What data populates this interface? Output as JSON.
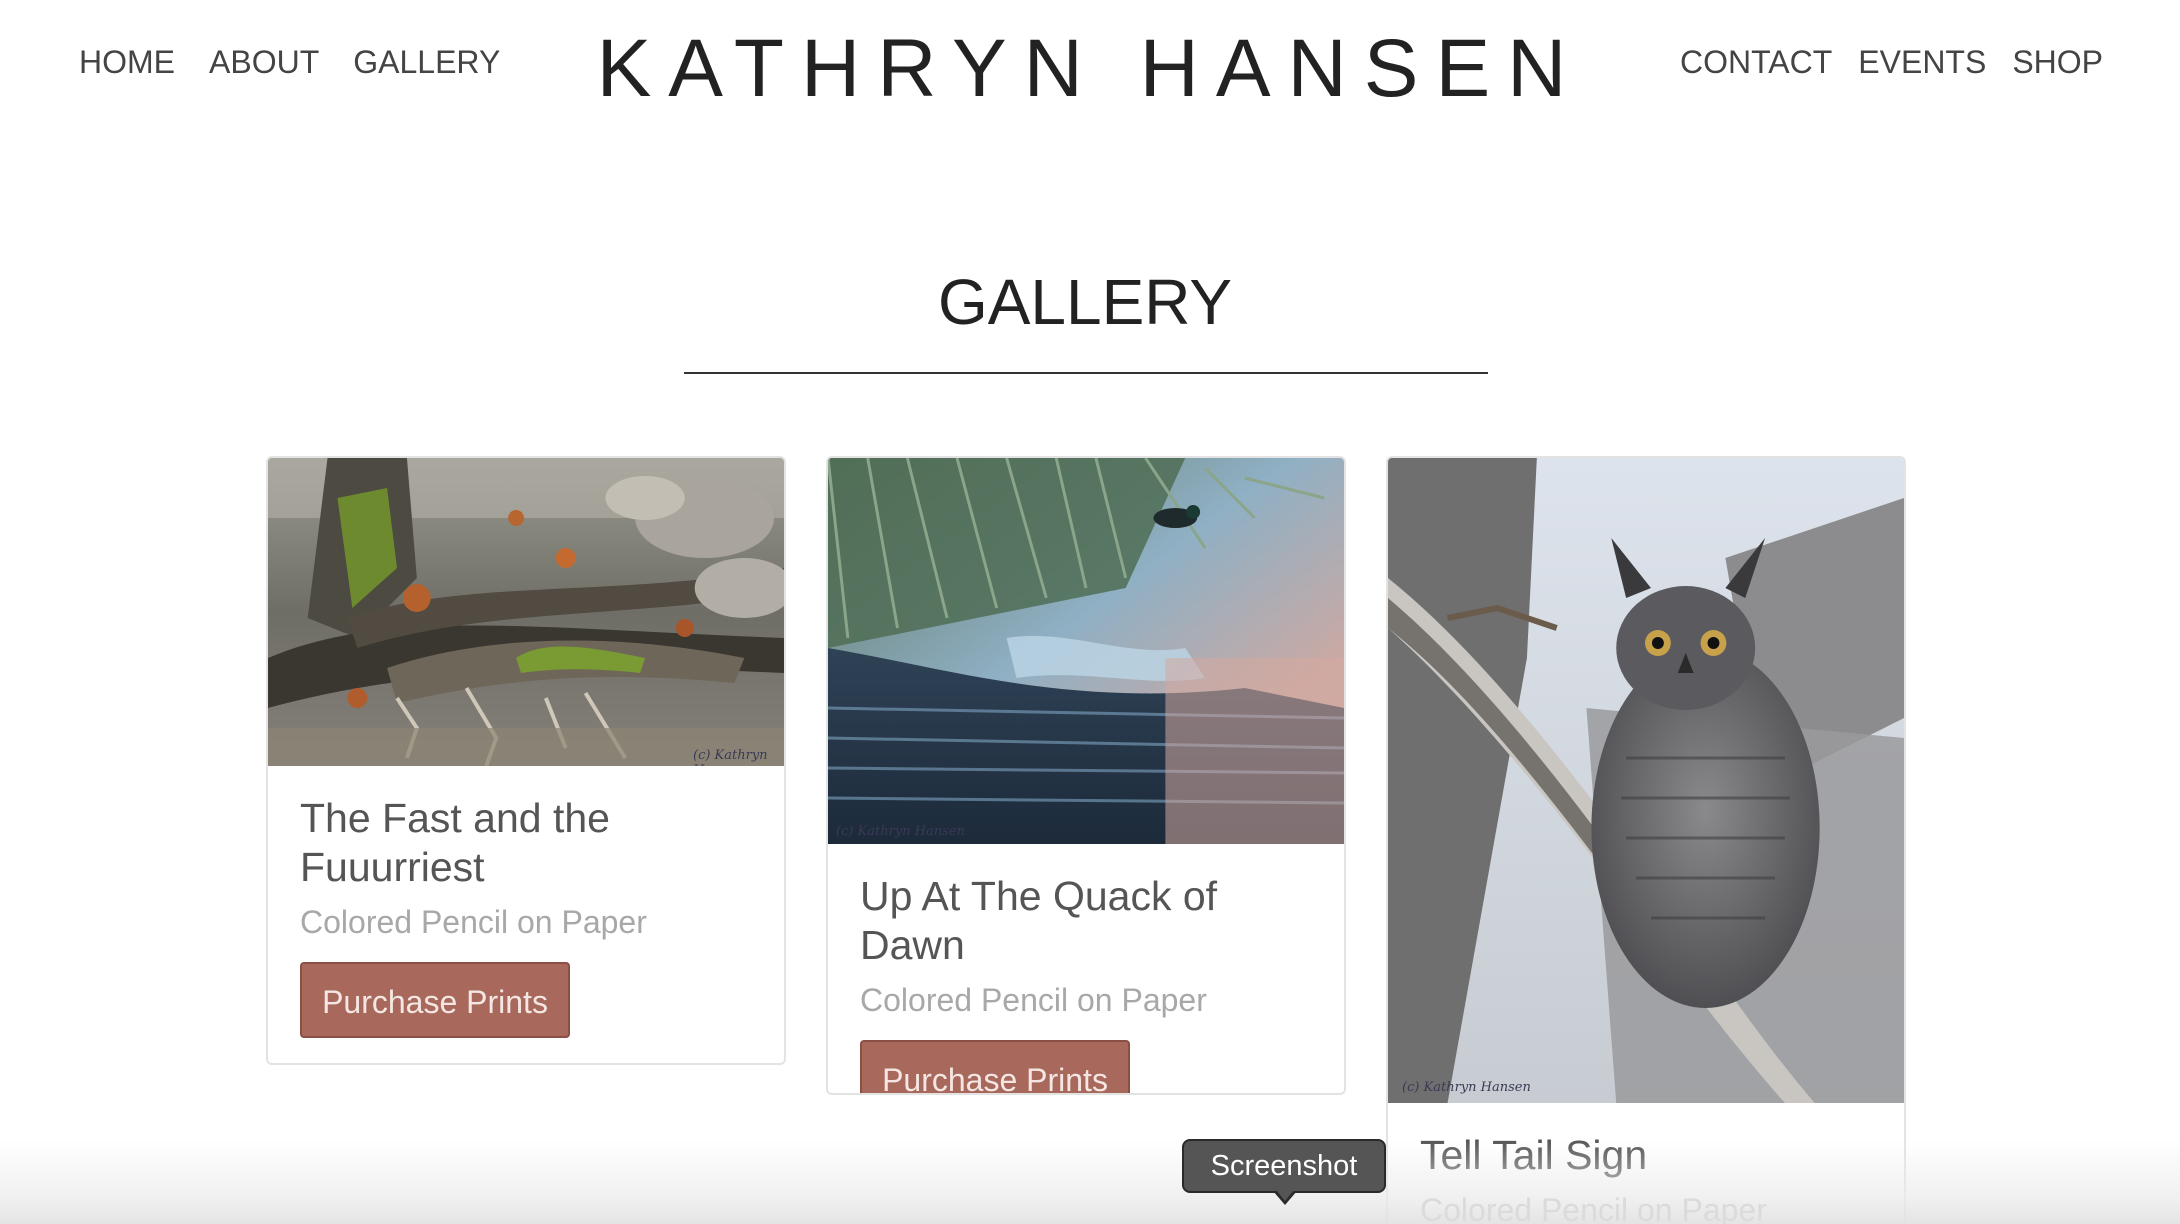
{
  "header": {
    "nav_left": [
      {
        "label": "HOME"
      },
      {
        "label": "ABOUT"
      },
      {
        "label": "GALLERY"
      }
    ],
    "site_title": "KATHRYN HANSEN",
    "nav_right": [
      {
        "label": "CONTACT"
      },
      {
        "label": "EVENTS"
      },
      {
        "label": "SHOP"
      }
    ]
  },
  "main": {
    "heading": "GALLERY",
    "cards": [
      {
        "title": "The Fast and the Fuuurriest",
        "medium": "Colored Pencil on Paper",
        "button_label": "Purchase Prints",
        "image_watermark": "(c) Kathryn Hansen"
      },
      {
        "title": "Up At The Quack of Dawn",
        "medium": "Colored Pencil on Paper",
        "button_label": "Purchase Prints",
        "image_watermark": "(c) Kathryn Hansen"
      },
      {
        "title": "Tell Tail Sign",
        "medium": "Colored Pencil on Paper",
        "image_watermark": "(c) Kathryn Hansen"
      }
    ]
  },
  "tooltip": {
    "label": "Screenshot"
  },
  "colors": {
    "button_bg": "#a8685c",
    "title_text": "#222222",
    "subtitle_text": "#a8a8a8"
  }
}
